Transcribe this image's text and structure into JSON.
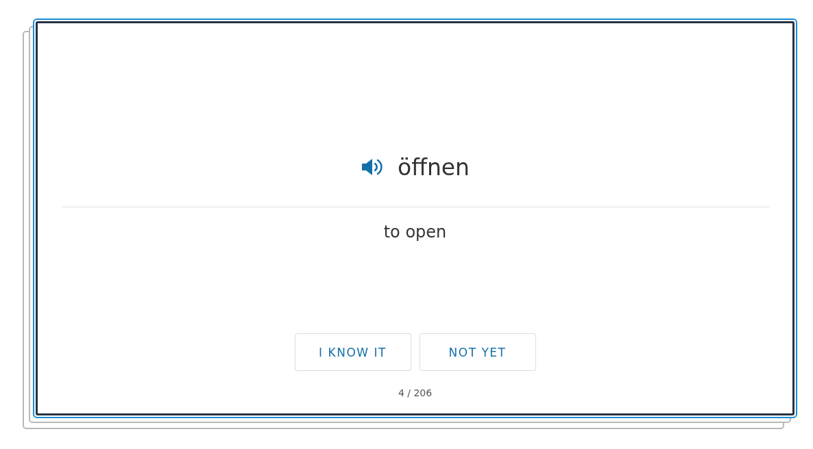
{
  "card": {
    "term": "öffnen",
    "definition": "to open"
  },
  "buttons": [
    "I KNOW IT",
    "NOT YET"
  ],
  "counter": "4 / 206"
}
